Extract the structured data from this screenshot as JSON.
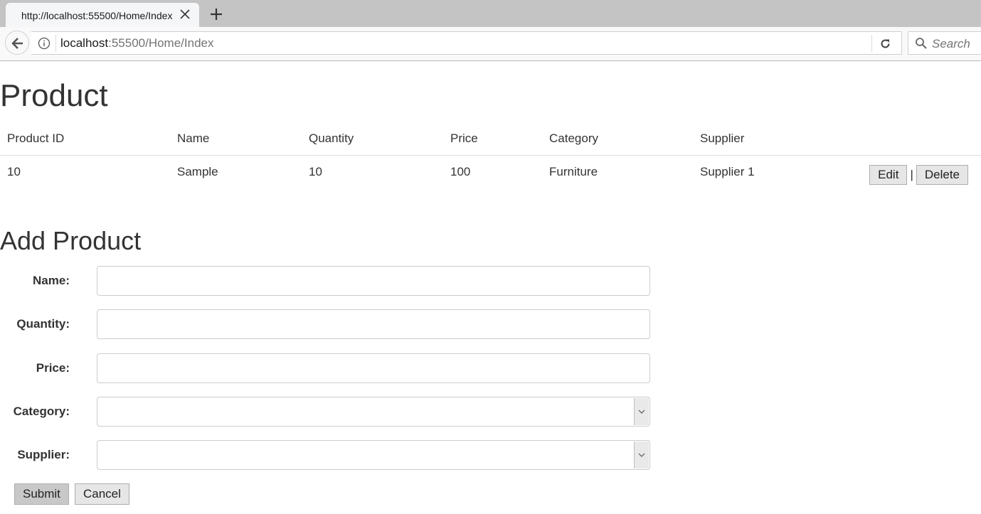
{
  "browser": {
    "tab_title": "http://localhost:55500/Home/Index",
    "url_host": "localhost",
    "url_rest": ":55500/Home/Index",
    "search_placeholder": "Search"
  },
  "page": {
    "title": "Product",
    "table": {
      "headers": [
        "Product ID",
        "Name",
        "Quantity",
        "Price",
        "Category",
        "Supplier"
      ],
      "rows": [
        {
          "id": "10",
          "name": "Sample",
          "quantity": "10",
          "price": "100",
          "category": "Furniture",
          "supplier": "Supplier 1"
        }
      ],
      "edit_label": "Edit",
      "separator": "|",
      "delete_label": "Delete"
    },
    "form": {
      "title": "Add Product",
      "name_label": "Name:",
      "quantity_label": "Quantity:",
      "price_label": "Price:",
      "category_label": "Category:",
      "supplier_label": "Supplier:",
      "name_value": "",
      "quantity_value": "",
      "price_value": "",
      "category_value": "",
      "supplier_value": "",
      "submit_label": "Submit",
      "cancel_label": "Cancel"
    }
  }
}
